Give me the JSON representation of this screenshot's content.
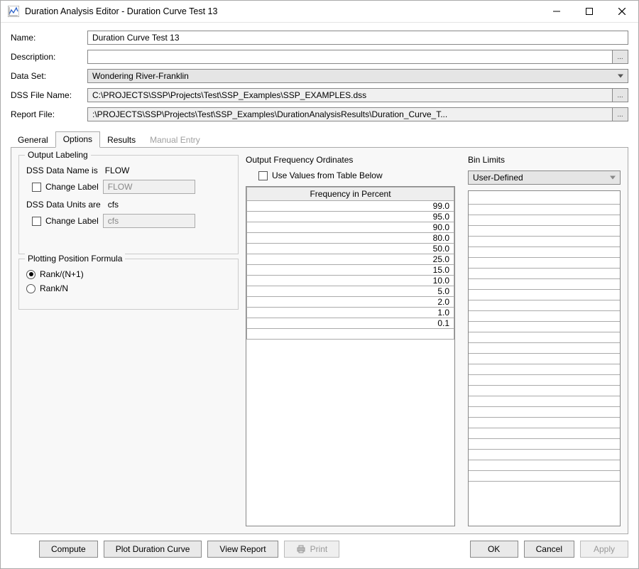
{
  "titlebar": {
    "title": "Duration Analysis Editor - Duration Curve Test 13",
    "minimize_tooltip": "Minimize",
    "maximize_tooltip": "Maximize",
    "close_tooltip": "Close"
  },
  "form": {
    "name_label": "Name:",
    "name_value": "Duration Curve Test 13",
    "description_label": "Description:",
    "description_value": "",
    "data_set_label": "Data Set:",
    "data_set_value": "Wondering River-Franklin",
    "dss_file_name_label": "DSS File Name:",
    "dss_file_name_value": "C:\\PROJECTS\\SSP\\Projects\\Test\\SSP_Examples\\SSP_EXAMPLES.dss",
    "report_file_label": "Report File:",
    "report_file_value": ":\\PROJECTS\\SSP\\Projects\\Test\\SSP_Examples\\DurationAnalysisResults\\Duration_Curve_T...",
    "browse_label": "..."
  },
  "tabs": {
    "general": "General",
    "options": "Options",
    "results": "Results",
    "manual_entry": "Manual Entry",
    "active": "Options"
  },
  "output_labeling": {
    "legend": "Output Labeling",
    "dss_name_is": "DSS Data Name is",
    "dss_name_value": "FLOW",
    "change_label": "Change Label",
    "change_label_value_1": "FLOW",
    "dss_units_are": "DSS Data Units are",
    "dss_units_value": "cfs",
    "change_label_value_2": "cfs"
  },
  "plotting_position": {
    "legend": "Plotting Position Formula",
    "rank_np1": "Rank/(N+1)",
    "rank_n": "Rank/N",
    "selected": "rank_np1"
  },
  "frequency_ordinates": {
    "title": "Output Frequency Ordinates",
    "use_values_label": "Use Values from Table Below",
    "header": "Frequency in Percent",
    "values": [
      "99.0",
      "95.0",
      "90.0",
      "80.0",
      "50.0",
      "25.0",
      "15.0",
      "10.0",
      "5.0",
      "2.0",
      "1.0",
      "0.1"
    ]
  },
  "bin_limits": {
    "title": "Bin Limits",
    "selected": "User-Defined",
    "rows": 27
  },
  "buttons": {
    "compute": "Compute",
    "plot": "Plot Duration Curve",
    "view_report": "View Report",
    "print": "Print",
    "ok": "OK",
    "cancel": "Cancel",
    "apply": "Apply"
  }
}
